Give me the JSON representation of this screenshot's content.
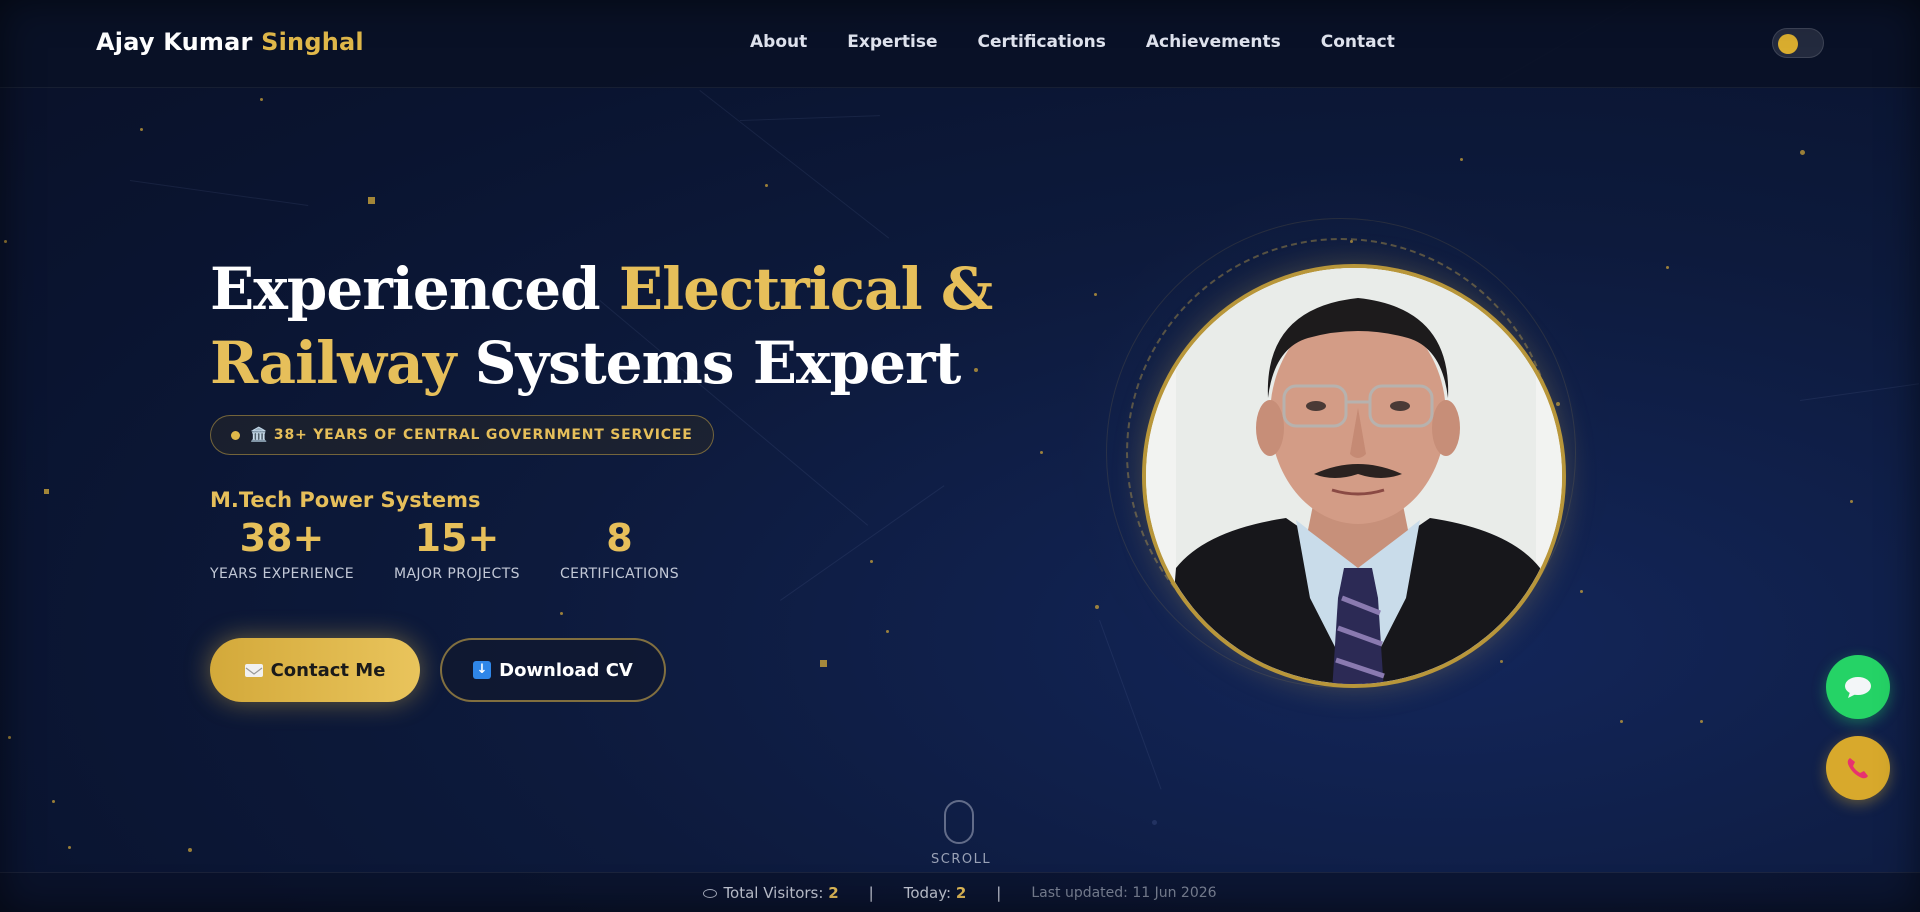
{
  "brand": {
    "first_name": "Ajay Kumar",
    "last_name": "Singhal"
  },
  "nav": {
    "items": [
      "About",
      "Expertise",
      "Certifications",
      "Achievements",
      "Contact"
    ]
  },
  "theme_toggle": {
    "state": "dark"
  },
  "hero": {
    "title_line1_white": "Experienced ",
    "title_line1_gold": "Electrical &",
    "title_line2_gold": "Railway",
    "title_line2_white": " Systems Expert",
    "badge_icon": "🏛️",
    "badge_text": "38+ YEARS OF CENTRAL GOVERNMENT SERVICEE",
    "degree": "M.Tech Power Systems",
    "stats": [
      {
        "value": "38+",
        "label": "YEARS EXPERIENCE"
      },
      {
        "value": "15+",
        "label": "MAJOR PROJECTS"
      },
      {
        "value": "8",
        "label": "CERTIFICATIONS"
      }
    ],
    "contact_button": "Contact Me",
    "cv_button": "Download CV",
    "scroll_label": "SCROLL"
  },
  "footer": {
    "visitors_label": "Total Visitors:",
    "visitors_value": "2",
    "today_label": "Today:",
    "today_value": "2",
    "separator": "|",
    "last_updated": "Last updated: 11 Jun 2026"
  },
  "colors": {
    "accent_gold": "#e0b84a",
    "background": "#0a1430",
    "whatsapp_green": "#25d366"
  },
  "icons": [
    "eye-icon",
    "mail-icon",
    "download-icon",
    "chat-icon",
    "phone-icon",
    "government-icon",
    "mouse-icon"
  ]
}
